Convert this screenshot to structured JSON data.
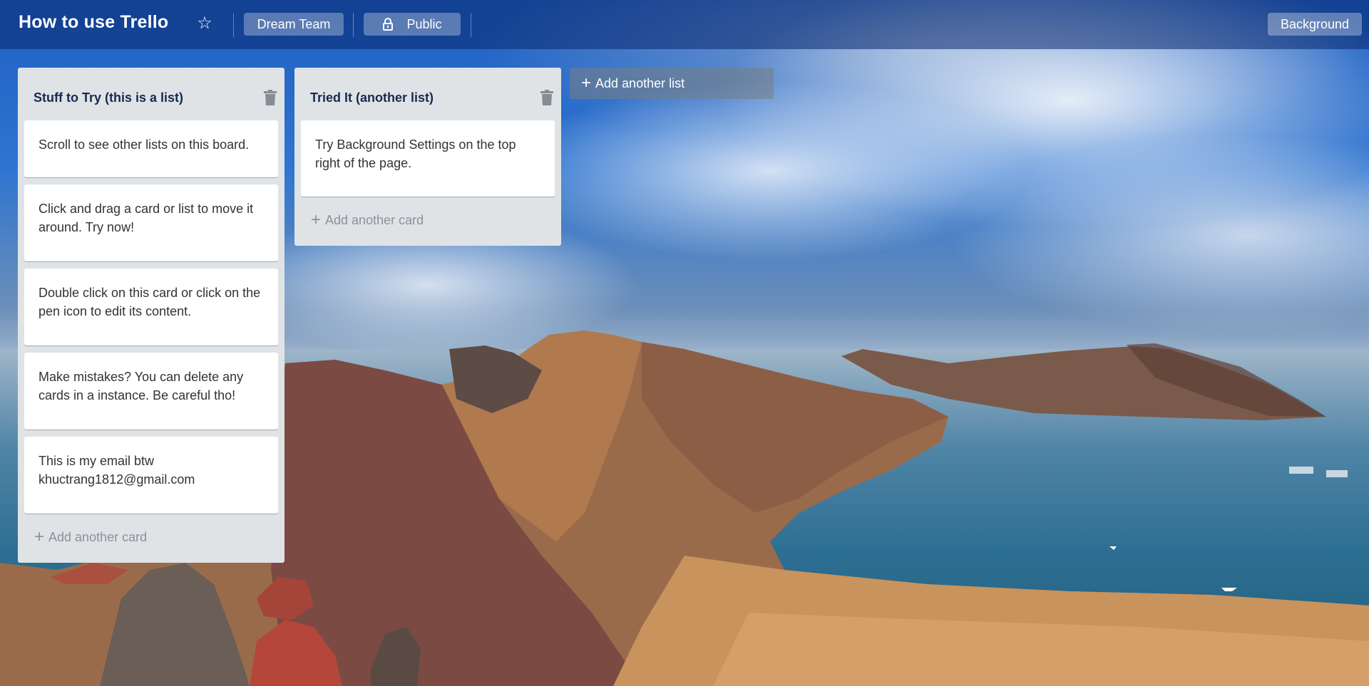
{
  "header": {
    "title": "How to use Trello",
    "team_label": "Dream Team",
    "visibility_label": "Public",
    "background_label": "Background"
  },
  "lists": [
    {
      "title": "Stuff to Try (this is a list)",
      "cards": [
        "Scroll to see other lists on this board.",
        "Click and drag a card or list to move it around. Try now!",
        "Double click on this card or click on the pen icon to edit its content.",
        "Make mistakes? You can delete any cards in a instance. Be careful tho!",
        "This is my email btw khuctrang1812@gmail.com"
      ],
      "add_card_label": "Add another card"
    },
    {
      "title": "Tried It (another list)",
      "cards": [
        "Try Background Settings on the top right of the page."
      ],
      "add_card_label": "Add another card"
    }
  ],
  "add_list_label": "Add another list",
  "icons": {
    "star": "star-icon",
    "lock": "lock-icon",
    "trash": "trash-icon",
    "plus": "plus-icon"
  },
  "colors": {
    "list_bg": "#dfe3e6",
    "card_bg": "#ffffff",
    "header_overlay": "#0a286e"
  }
}
